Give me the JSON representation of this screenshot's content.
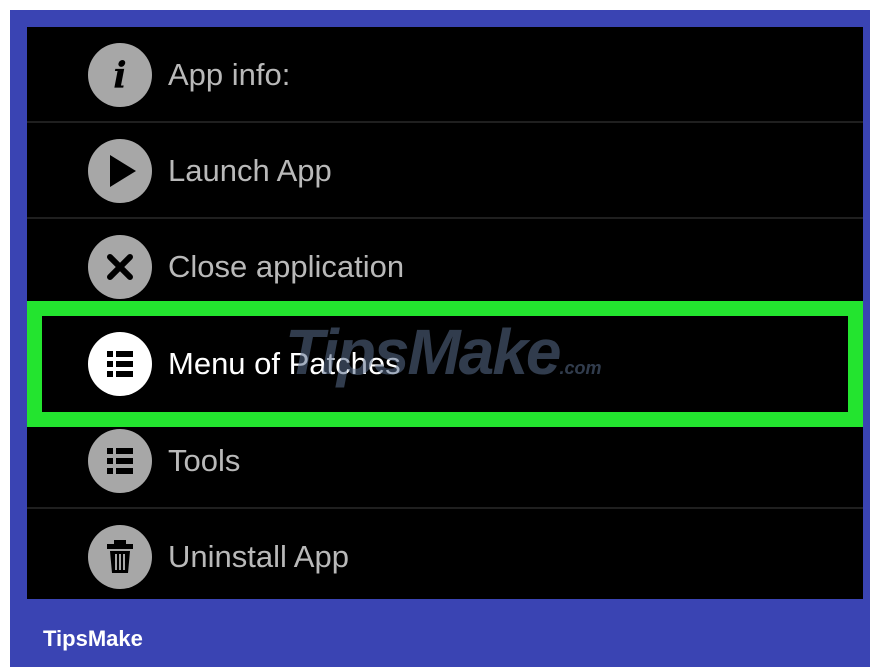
{
  "menu": {
    "items": [
      {
        "label": "App info:",
        "icon": "info-icon"
      },
      {
        "label": "Launch App",
        "icon": "play-icon"
      },
      {
        "label": "Close application",
        "icon": "close-icon"
      },
      {
        "label": "Menu of Patches",
        "icon": "list-icon",
        "highlighted": true
      },
      {
        "label": "Tools",
        "icon": "list-icon"
      },
      {
        "label": "Uninstall App",
        "icon": "trash-icon"
      }
    ]
  },
  "watermark": {
    "text": "TipsMake",
    "suffix": ".com"
  },
  "brand": {
    "text": "TipsMake"
  },
  "colors": {
    "frame": "#3a44b3",
    "highlight": "#23e42f",
    "icon_bg": "#a7a7a7",
    "text": "#b9b9b9"
  }
}
